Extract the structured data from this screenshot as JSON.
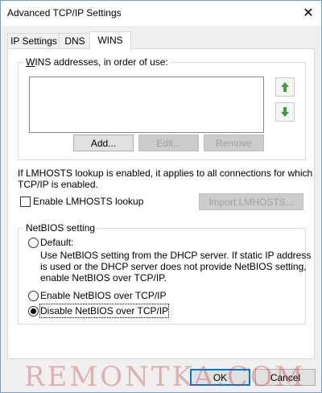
{
  "window": {
    "title": "Advanced TCP/IP Settings",
    "close_glyph": "✕"
  },
  "tabs": [
    {
      "label": "IP Settings",
      "active": false
    },
    {
      "label": "DNS",
      "active": false
    },
    {
      "label": "WINS",
      "active": true
    }
  ],
  "wins": {
    "group_label": "WINS addresses, in order of use:",
    "addresses": [],
    "move_up_icon": "arrow-up-icon",
    "move_down_icon": "arrow-down-icon",
    "add_label": "Add...",
    "edit_label": "Edit...",
    "remove_label": "Remove"
  },
  "lmhosts": {
    "info_line1": "If LMHOSTS lookup is enabled, it applies to all connections for which",
    "info_line2": "TCP/IP is enabled.",
    "enable_label": "Enable LMHOSTS lookup",
    "enable_checked": false,
    "import_label": "Import LMHOSTS..."
  },
  "netbios": {
    "group_label": "NetBIOS setting",
    "default_label": "Default:",
    "default_desc_1": "Use NetBIOS setting from the DHCP server. If static IP address",
    "default_desc_2": "is used or the DHCP server does not provide NetBIOS setting,",
    "default_desc_3": "enable NetBIOS over TCP/IP.",
    "enable_label": "Enable NetBIOS over TCP/IP",
    "disable_label": "Disable NetBIOS over TCP/IP",
    "selected": "disable"
  },
  "footer": {
    "ok_label": "OK",
    "cancel_label": "Cancel"
  },
  "watermark": "REMONTKA.COM",
  "colors": {
    "arrow_green": "#3aa03a",
    "default_button_border": "#0078d7",
    "watermark": "#b93c3c"
  }
}
